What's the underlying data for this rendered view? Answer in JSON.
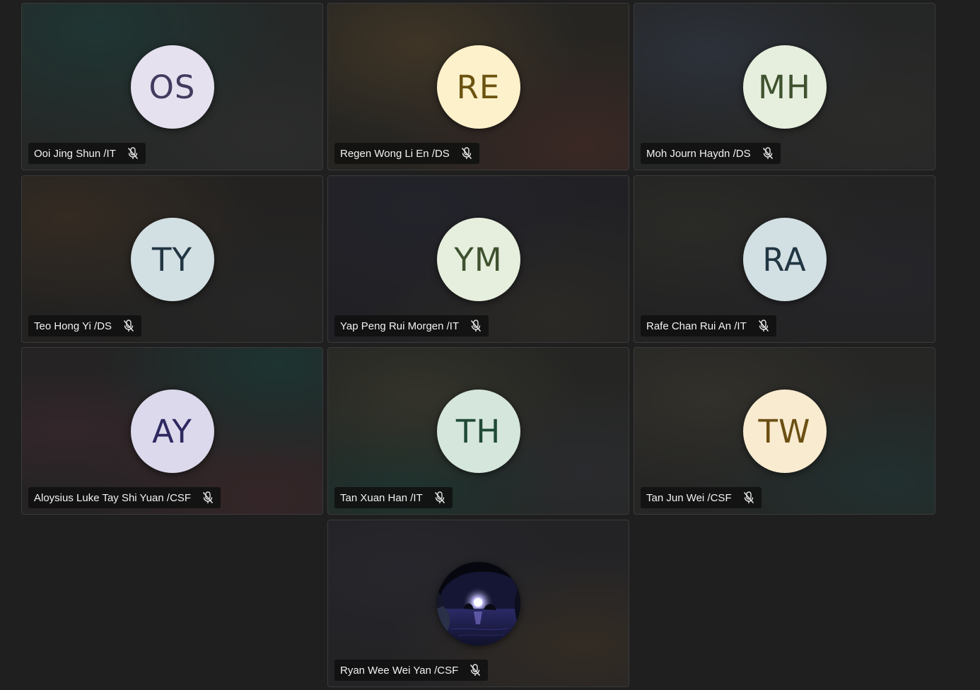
{
  "participants": [
    {
      "initials": "OS",
      "name": "Ooi Jing Shun /IT",
      "avatar_bg": "#e5e1ef",
      "avatar_fg": "#433a5f",
      "muted": true
    },
    {
      "initials": "RE",
      "name": "Regen Wong Li En /DS",
      "avatar_bg": "#fdf1cb",
      "avatar_fg": "#6b520f",
      "muted": true
    },
    {
      "initials": "MH",
      "name": "Moh Journ Haydn /DS",
      "avatar_bg": "#e6efdd",
      "avatar_fg": "#3f5230",
      "muted": true
    },
    {
      "initials": "TY",
      "name": "Teo Hong Yi /DS",
      "avatar_bg": "#d2dfe3",
      "avatar_fg": "#213642",
      "muted": true
    },
    {
      "initials": "YM",
      "name": "Yap Peng Rui Morgen /IT",
      "avatar_bg": "#e6efdd",
      "avatar_fg": "#3f5230",
      "muted": true
    },
    {
      "initials": "RA",
      "name": "Rafe Chan Rui An /IT",
      "avatar_bg": "#d2dfe3",
      "avatar_fg": "#213642",
      "muted": true
    },
    {
      "initials": "AY",
      "name": "Aloysius Luke Tay Shi Yuan /CSF",
      "avatar_bg": "#dcd9ec",
      "avatar_fg": "#2e2960",
      "muted": true
    },
    {
      "initials": "TH",
      "name": "Tan Xuan Han /IT",
      "avatar_bg": "#d5e6dc",
      "avatar_fg": "#1f4a35",
      "muted": true
    },
    {
      "initials": "TW",
      "name": "Tan Jun Wei /CSF",
      "avatar_bg": "#f8ebd0",
      "avatar_fg": "#6b4f12",
      "muted": true
    },
    {
      "initials": "",
      "name": "Ryan Wee Wei Yan /CSF",
      "avatar_bg": "#0b0d18",
      "avatar_fg": "#ffffff",
      "muted": true,
      "photo": true
    }
  ]
}
